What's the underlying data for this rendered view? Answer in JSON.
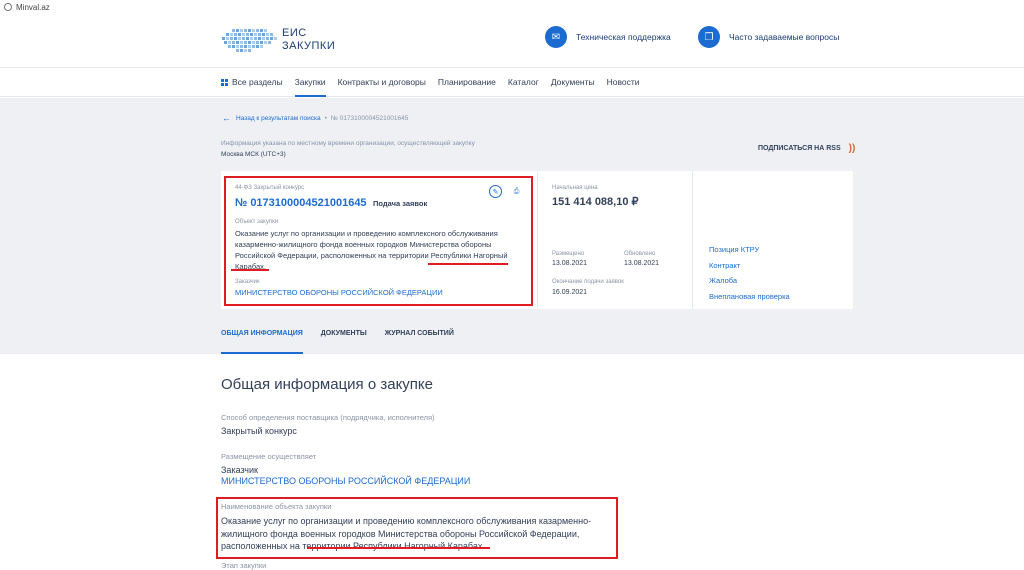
{
  "browser": {
    "tab_title": "Minval.az"
  },
  "header": {
    "logo_line1": "ЕИС",
    "logo_line2": "ЗАКУПКИ",
    "support_label": "Техническая поддержка",
    "faq_label": "Часто задаваемые вопросы"
  },
  "nav": {
    "items": [
      "Все разделы",
      "Закупки",
      "Контракты и договоры",
      "Планирование",
      "Каталог",
      "Документы",
      "Новости"
    ]
  },
  "breadcrumb": {
    "back": "Назад к результатам поиска",
    "separator": "•",
    "current": "№ 0173100004521001645"
  },
  "timezone": {
    "note": "Информация указана по местному времени организации, осуществляющей закупку",
    "value": "Москва МСК (UTC+3)"
  },
  "rss": {
    "label": "ПОДПИСАТЬСЯ НА RSS"
  },
  "card_main": {
    "law": "44-ФЗ Закрытый конкурс",
    "number": "№ 0173100004521001645",
    "status": "Подача заявок",
    "object_label": "Объект закупки",
    "object_text": "Оказание услуг по организации и проведению комплексного обслуживания казарменно-жилищного фонда военных городков Министерства обороны Российской Федерации, расположенных на территории Республики Нагорный Карабах.",
    "customer_label": "Заказчик",
    "customer": "МИНИСТЕРСТВО ОБОРОНЫ РОССИЙСКОЙ ФЕДЕРАЦИИ"
  },
  "card_price": {
    "price_label": "Начальная цена",
    "price": "151 414 088,10 ₽",
    "posted_label": "Размещено",
    "posted": "13.08.2021",
    "updated_label": "Обновлено",
    "updated": "13.08.2021",
    "deadline_label": "Окончание подачи заявок",
    "deadline": "16.09.2021"
  },
  "card_links": [
    "Позиция КТРУ",
    "Контракт",
    "Жалоба",
    "Внеплановая проверка"
  ],
  "tabs": [
    "ОБЩАЯ ИНФОРМАЦИЯ",
    "ДОКУМЕНТЫ",
    "ЖУРНАЛ СОБЫТИЙ"
  ],
  "general": {
    "title": "Общая информация о закупке",
    "method_label": "Способ определения поставщика (подрядчика, исполнителя)",
    "method": "Закрытый конкурс",
    "placement_label": "Размещение осуществляет",
    "placement_role": "Заказчик",
    "placement_org": "МИНИСТЕРСТВО ОБОРОНЫ РОССИЙСКОЙ ФЕДЕРАЦИИ",
    "object_name_label": "Наименование объекта закупки",
    "object_name": "Оказание услуг по организации и проведению комплексного обслуживания казарменно-жилищного фонда военных городков Министерства обороны Российской Федерации, расположенных на территории Республики Нагорный Карабах.",
    "stage_label": "Этап закупки"
  },
  "colors": {
    "accent": "#1b6bd0",
    "highlight": "#e01b24",
    "text": "#334059",
    "muted": "#8a93a6"
  }
}
